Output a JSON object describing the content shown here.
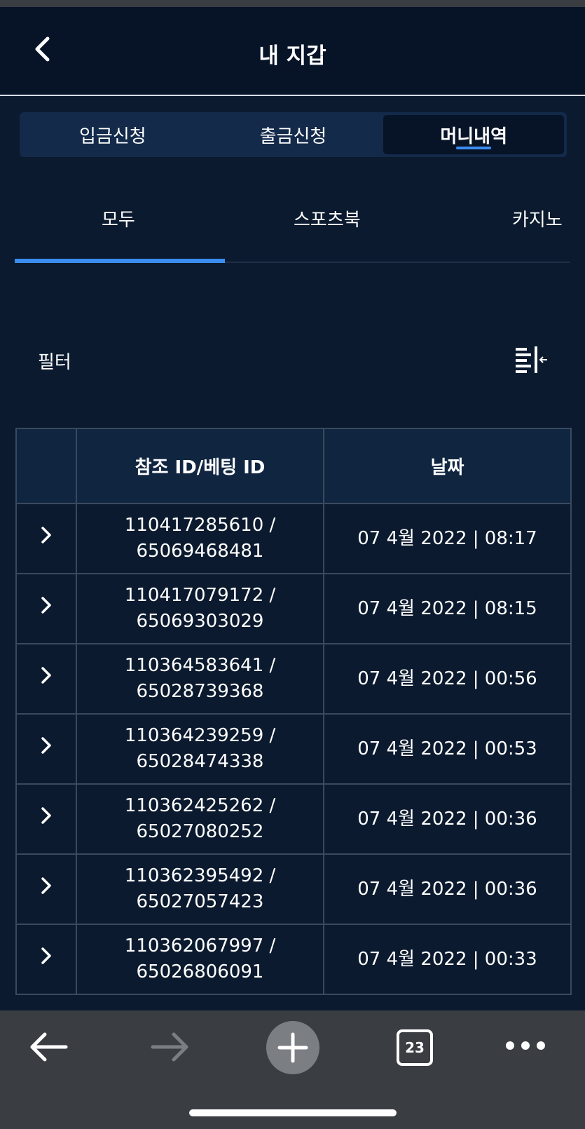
{
  "header": {
    "title": "내 지갑",
    "back_icon": "chevron-left-icon"
  },
  "segments": [
    {
      "label": "입금신청",
      "active": false
    },
    {
      "label": "출금신청",
      "active": false
    },
    {
      "label": "머니내역",
      "active": true
    }
  ],
  "subtabs": [
    {
      "label": "모두",
      "active": true
    },
    {
      "label": "스포츠북",
      "active": false
    },
    {
      "label": "카지노",
      "active": false
    }
  ],
  "filter": {
    "label": "필터",
    "icon": "filter-panel-icon"
  },
  "table": {
    "headers": {
      "id": "참조 ID/베팅 ID",
      "date": "날짜"
    },
    "rows": [
      {
        "ref_id": "110417285610 /",
        "bet_id": "65069468481",
        "date": "07 4월 2022 | 08:17"
      },
      {
        "ref_id": "110417079172 /",
        "bet_id": "65069303029",
        "date": "07 4월 2022 | 08:15"
      },
      {
        "ref_id": "110364583641 /",
        "bet_id": "65028739368",
        "date": "07 4월 2022 | 00:56"
      },
      {
        "ref_id": "110364239259 /",
        "bet_id": "65028474338",
        "date": "07 4월 2022 | 00:53"
      },
      {
        "ref_id": "110362425262 /",
        "bet_id": "65027080252",
        "date": "07 4월 2022 | 00:36"
      },
      {
        "ref_id": "110362395492 /",
        "bet_id": "65027057423",
        "date": "07 4월 2022 | 00:36"
      },
      {
        "ref_id": "110362067997 /",
        "bet_id": "65026806091",
        "date": "07 4월 2022 | 00:33"
      }
    ]
  },
  "browser_bar": {
    "tab_count": "23",
    "icons": [
      "back-arrow-icon",
      "forward-arrow-icon",
      "plus-icon",
      "tabs-icon",
      "more-icon"
    ]
  },
  "colors": {
    "background": "#0b1a2e",
    "accent": "#3b8cf0",
    "bar": "#3a3d42"
  }
}
